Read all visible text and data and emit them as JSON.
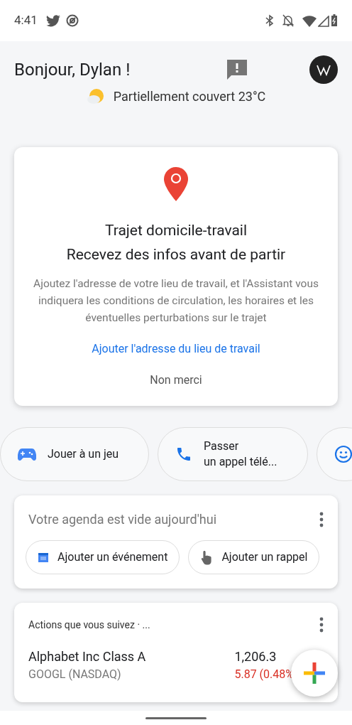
{
  "status_bar": {
    "time": "4:41"
  },
  "header": {
    "greeting": "Bonjour, Dylan !",
    "weather": "Partiellement couvert 23°C"
  },
  "commute_card": {
    "title": "Trajet domicile-travail",
    "subtitle": "Recevez des infos avant de partir",
    "body": "Ajoutez l'adresse de votre lieu de travail, et l'Assistant vous indiquera les conditions de circulation, les horaires et les éventuelles perturbations sur le trajet",
    "link": "Ajouter l'adresse du lieu de travail",
    "dismiss": "Non merci"
  },
  "suggestions": [
    {
      "kind": "game",
      "lines": [
        "Jouer à un jeu"
      ]
    },
    {
      "kind": "phone",
      "lines": [
        "Passer",
        "un appel télé..."
      ]
    },
    {
      "kind": "smiley"
    }
  ],
  "agenda_card": {
    "title": "Votre agenda est vide aujourd'hui",
    "actions": [
      {
        "kind": "calendar",
        "label": "Ajouter un événement"
      },
      {
        "kind": "reminder",
        "label": "Ajouter un rappel"
      }
    ]
  },
  "stocks_card": {
    "title": "Actions que vous suivez · ...",
    "stock": {
      "name": "Alphabet Inc Class A",
      "ticker": "GOOGL (NASDAQ)",
      "price": "1,206.3",
      "change": "5.87 (0.48%"
    }
  }
}
